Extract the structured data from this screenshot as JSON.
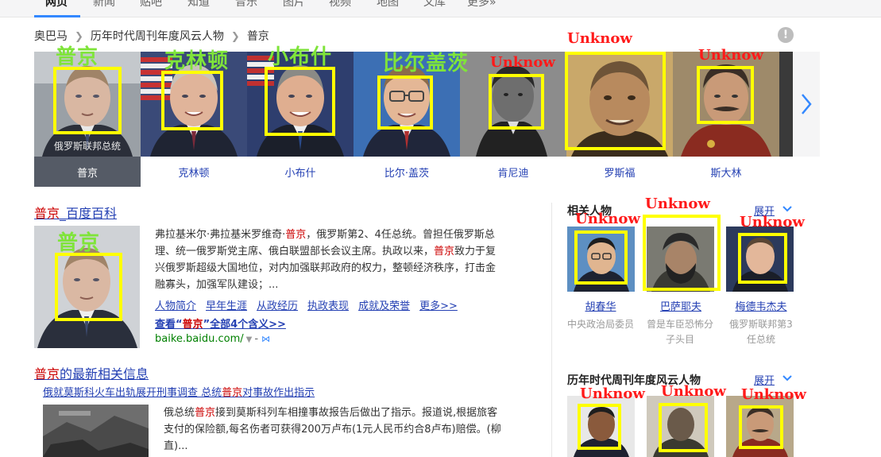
{
  "nav": {
    "items": [
      "网页",
      "新闻",
      "贴吧",
      "知道",
      "音乐",
      "图片",
      "视频",
      "地图",
      "文库",
      "更多»"
    ]
  },
  "breadcrumb": {
    "items": [
      "奥巴马",
      "历年时代周刊年度风云人物",
      "普京"
    ]
  },
  "alert_icon": "!",
  "carousel": {
    "people": [
      {
        "name": "普京",
        "caption": "俄罗斯联邦总统",
        "active": true
      },
      {
        "name": "克林顿"
      },
      {
        "name": "小布什"
      },
      {
        "name": "比尔·盖茨"
      },
      {
        "name": "肯尼迪"
      },
      {
        "name": "罗斯福"
      },
      {
        "name": "斯大林"
      }
    ]
  },
  "annotations": {
    "green_labels": [
      "普京",
      "克林顿",
      "小布什",
      "比尔盖茨",
      "普京"
    ],
    "red_label": "Unknow"
  },
  "baike": {
    "title_em": "普京",
    "title_rest": "_百度百科",
    "p1": "弗拉基米尔·弗拉基米罗维奇·",
    "p1_em": "普京",
    "p2": "，俄罗斯第2、4任总统。曾担任俄罗斯总理、统一俄罗斯党主席、俄白联盟部长会议主席。执政以来，",
    "p2_em": "普京",
    "p3": "致力于复兴俄罗斯超级大国地位，对内加强联邦政府的权力，整顿经济秩序，打击金融寡头，加强军队建设；...",
    "links": [
      "人物简介",
      "早年生涯",
      "从政经历",
      "执政表现",
      "成就及荣誉",
      "更多>>"
    ],
    "all_prefix": "查看“",
    "all_em": "普京",
    "all_suffix": "”全部4个含义>>",
    "url": "baike.baidu.com/",
    "url_drop": "▼",
    "url_dash": "-",
    "url_bird": "⋈"
  },
  "news": {
    "title_em": "普京",
    "title_rest": "的最新相关信息",
    "link_pre": "俄就莫斯科火车出轨展开刑事调查 总统",
    "link_em": "普京",
    "link_post": "对事故作出指示",
    "text_pre": "俄总统",
    "text_em": "普京",
    "text_post": "接到莫斯科列车相撞事故报告后做出了指示。报道说,根据旅客支付的保险额,每名伤者可获得200万卢布(1元人民币约合8卢布)赔偿。(柳直)..."
  },
  "related": {
    "title": "相关人物",
    "expand": "展开",
    "people": [
      {
        "name": "胡春华",
        "desc": "中央政治局委员"
      },
      {
        "name": "巴萨耶夫",
        "desc": "曾是车臣恐怖分子头目"
      },
      {
        "name": "梅德韦杰夫",
        "desc": "俄罗斯联邦第3任总统"
      }
    ]
  },
  "persons_of_year": {
    "title": "历年时代周刊年度风云人物",
    "expand": "展开"
  },
  "colors": {
    "link": "#2440b3",
    "highlight": "#cc0000",
    "box": "#ffff00",
    "label_green": "#7fe43a",
    "label_red": "#ff1a1a"
  }
}
